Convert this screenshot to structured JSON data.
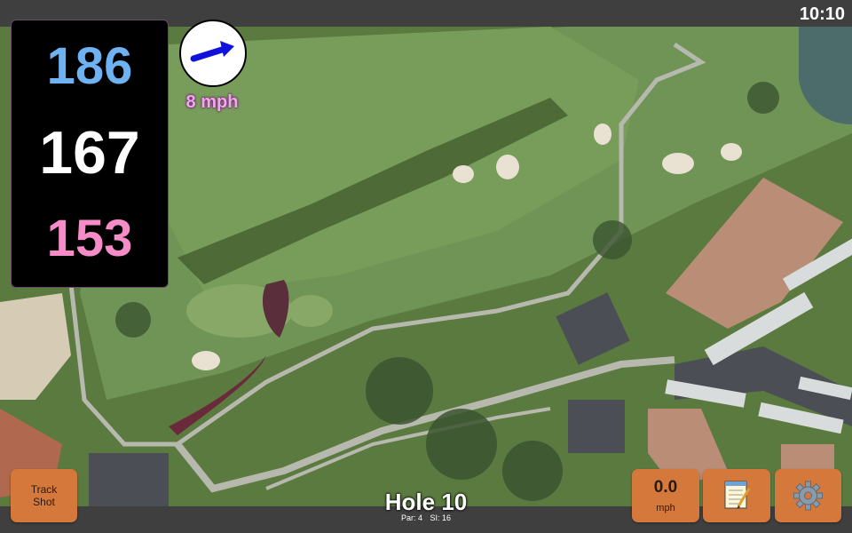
{
  "status": {
    "time": "10:10"
  },
  "distances": {
    "back": "186",
    "center": "167",
    "front": "153"
  },
  "wind": {
    "speed": "8 mph",
    "direction_icon": "arrow-icon"
  },
  "hole": {
    "title": "Hole 10",
    "par": "Par: 4",
    "stroke_index": "SI: 16"
  },
  "buttons": {
    "track_line1": "Track",
    "track_line2": "Shot",
    "speed_value": "0.0",
    "speed_unit": "mph",
    "notes_icon": "notepad-icon",
    "settings_icon": "gear-icon"
  },
  "colors": {
    "back_distance": "#6fb2f1",
    "center_distance": "#ffffff",
    "front_distance": "#f58cc8",
    "button": "#d4783c",
    "wind_label": "#f2a6f0"
  }
}
